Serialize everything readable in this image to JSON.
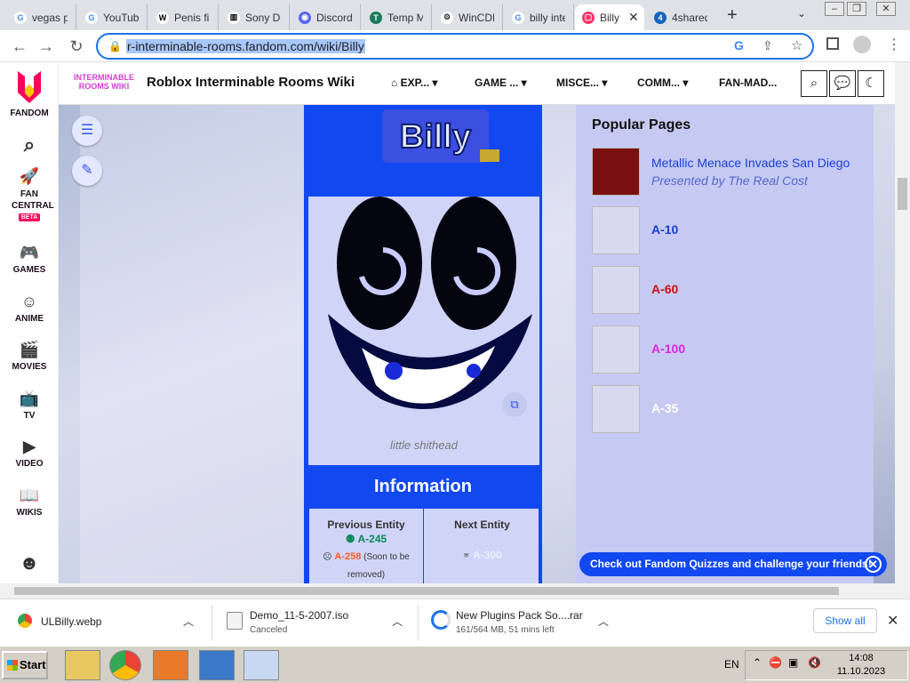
{
  "browser": {
    "tabs": [
      {
        "title": "vegas p",
        "fav": "G",
        "color": "#4285f4"
      },
      {
        "title": "YouTub",
        "fav": "G",
        "color": "#4285f4"
      },
      {
        "title": "Penis fi",
        "fav": "W",
        "color": "#000000"
      },
      {
        "title": "Sony De",
        "fav": "▥",
        "color": "#000000"
      },
      {
        "title": "Discord",
        "fav": "◉",
        "color": "#5865f2"
      },
      {
        "title": "Temp M",
        "fav": "T",
        "color": "#1b7a5a"
      },
      {
        "title": "WinCDE",
        "fav": "⚙",
        "color": "#333333"
      },
      {
        "title": "billy inte",
        "fav": "G",
        "color": "#4285f4"
      },
      {
        "title": "Billy",
        "fav": "▢",
        "color": "#ff3366"
      },
      {
        "title": "4shared",
        "fav": "4",
        "color": "#1565c0"
      }
    ],
    "new_tab": "+",
    "url": "r-interminable-rooms.fandom.com/wiki/Billy"
  },
  "rail": {
    "items": [
      {
        "label": "FANDOM",
        "icon": "fandom-logo-icon"
      },
      {
        "label": "",
        "icon": "search-icon"
      },
      {
        "label": "FAN CENTRAL",
        "badge": "BETA",
        "icon": "rocket-icon"
      },
      {
        "label": "GAMES",
        "icon": "gamepad-icon"
      },
      {
        "label": "ANIME",
        "icon": "anime-icon"
      },
      {
        "label": "MOVIES",
        "icon": "clapper-icon"
      },
      {
        "label": "TV",
        "icon": "tv-icon"
      },
      {
        "label": "VIDEO",
        "icon": "play-icon"
      },
      {
        "label": "WIKIS",
        "icon": "book-icon"
      }
    ]
  },
  "wiki": {
    "logo_text": "INTERMINABLE ROOMS WIKI",
    "title": "Roblox Interminable Rooms Wiki",
    "nav": [
      "EXP...",
      "GAME ...",
      "MISCE...",
      "COMM...",
      "FAN-MAD..."
    ]
  },
  "infobox": {
    "caption": "little shithead",
    "section_title": "Information",
    "prev_label": "Previous Entity",
    "next_label": "Next Entity",
    "prev_entity": "A-245",
    "prev_entity2": "A-258",
    "prev_note": "(Soon to be removed)",
    "next_entity": "A-300",
    "logo_text": "Billy"
  },
  "popular": {
    "title": "Popular Pages",
    "items": [
      {
        "name": "Metallic Menace Invades San Diego",
        "sub": "Presented by The Real Cost",
        "color": "#1a3fd9"
      },
      {
        "name": "A-10",
        "color": "#1a3fd9"
      },
      {
        "name": "A-60",
        "color": "#cc1111"
      },
      {
        "name": "A-100",
        "color": "#e026e0"
      },
      {
        "name": "A-35",
        "color": "#ffffff"
      }
    ]
  },
  "quiz_banner": "Check out Fandom Quizzes and challenge your friends!",
  "downloads": [
    {
      "name": "ULBilly.webp",
      "status": ""
    },
    {
      "name": "Demo_11-5-2007.iso",
      "status": "Canceled"
    },
    {
      "name": "New Plugins Pack So....rar",
      "status": "161/564 MB, 51 mins left"
    }
  ],
  "show_all": "Show all",
  "taskbar": {
    "start": "Start",
    "lang": "EN",
    "time": "14:08",
    "date": "11.10.2023"
  }
}
